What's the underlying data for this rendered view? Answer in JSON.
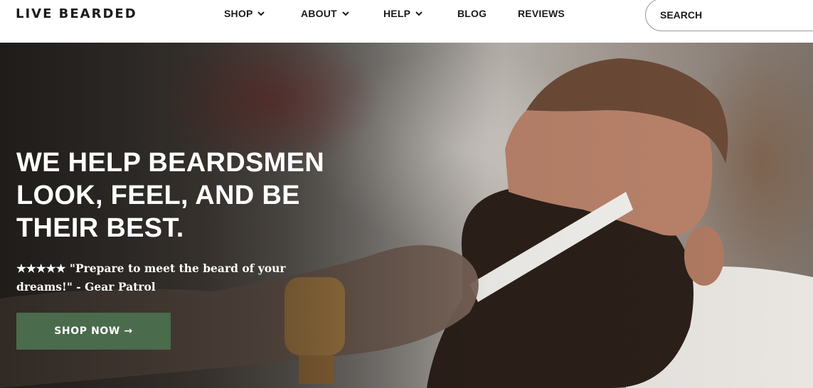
{
  "brand": {
    "logo_text": "LIVE BEARDED"
  },
  "nav": {
    "items": [
      {
        "label": "SHOP",
        "has_dropdown": true
      },
      {
        "label": "ABOUT",
        "has_dropdown": true
      },
      {
        "label": "HELP",
        "has_dropdown": true
      },
      {
        "label": "BLOG",
        "has_dropdown": false
      },
      {
        "label": "REVIEWS",
        "has_dropdown": false
      }
    ],
    "search": {
      "placeholder": "SEARCH",
      "value": ""
    }
  },
  "hero": {
    "headline": "WE HELP BEARDSMEN LOOK, FEEL, AND BE THEIR BEST.",
    "quote": "★★★★★ \"Prepare to meet the beard of your dreams!\" - Gear Patrol",
    "cta_label": "SHOP NOW →",
    "image_subject": "bearded man combing beard at barbershop"
  },
  "colors": {
    "cta_background": "#4a6b4c",
    "text_dark": "#1b1b1b",
    "text_light": "#ffffff"
  }
}
